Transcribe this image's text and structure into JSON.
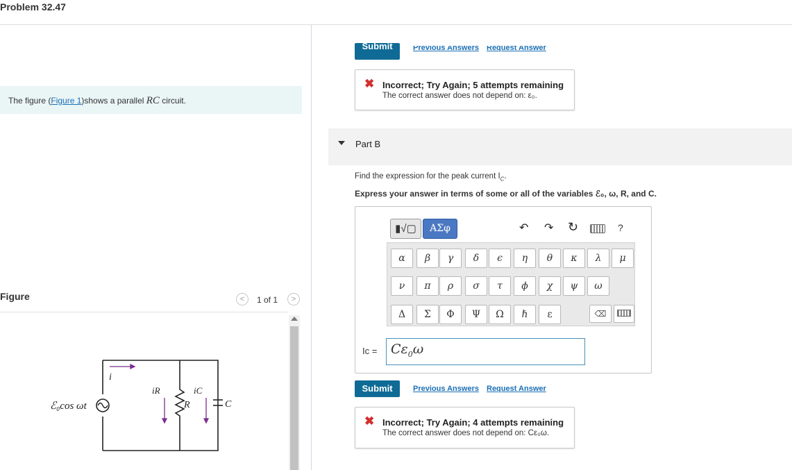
{
  "problem_title": "Problem 32.47",
  "left": {
    "intro": {
      "pre": "The figure (",
      "link": "Figure 1",
      "post": ")shows a parallel ",
      "var": "RC",
      "tail": " circuit."
    },
    "figure_label": "Figure",
    "pager": {
      "text": "1 of 1",
      "prev": "<",
      "next": ">"
    },
    "circuit": {
      "source_label": "ℰ₀cos ωt",
      "i_label": "i",
      "iR_label": "iR",
      "iC_label": "iC",
      "R_label": "R",
      "C_label": "C"
    }
  },
  "top_actions": {
    "submit": "Submit",
    "previous": "Previous Answers",
    "request": "Request Answer"
  },
  "feedback1": {
    "heading": "Incorrect; Try Again; 5 attempts remaining",
    "detail": "The correct answer does not depend on: ε₀."
  },
  "partB": {
    "label": "Part B",
    "question": "Find the expression for the peak current I",
    "question_sub": "C",
    "instruction": "Express your answer in terms of some or all of the variables ℰ₀, ω, R, and C."
  },
  "editor": {
    "template_btn": "▮√▢",
    "greek_btn": "ΑΣφ",
    "undo": "↶",
    "redo": "↷",
    "reset": "↻",
    "help": "?",
    "row1": [
      "α",
      "β",
      "γ",
      "δ",
      "ϵ",
      "η",
      "θ",
      "κ",
      "λ",
      "μ"
    ],
    "row2": [
      "ν",
      "π",
      "ρ",
      "σ",
      "τ",
      "ϕ",
      "χ",
      "ψ",
      "ω"
    ],
    "row3": [
      "Δ",
      "Σ",
      "Φ",
      "Ψ",
      "Ω",
      "ℏ",
      "ε"
    ],
    "delete_key": "⌫",
    "answer_label": "Ic =",
    "answer_value": "Cε",
    "answer_sub": "0",
    "answer_tail": "ω"
  },
  "bottom_actions": {
    "submit": "Submit",
    "previous": "Previous Answers",
    "request": "Request Answer"
  },
  "feedback2": {
    "heading": "Incorrect; Try Again; 4 attempts remaining",
    "detail": "The correct answer does not depend on: Cε₀ω."
  },
  "colors": {
    "submit_bg": "#0f6b96",
    "link": "#1a6fb5",
    "error": "#d32f2f",
    "greek_btn": "#4a78c2",
    "arrow": "#7b2d8e"
  }
}
